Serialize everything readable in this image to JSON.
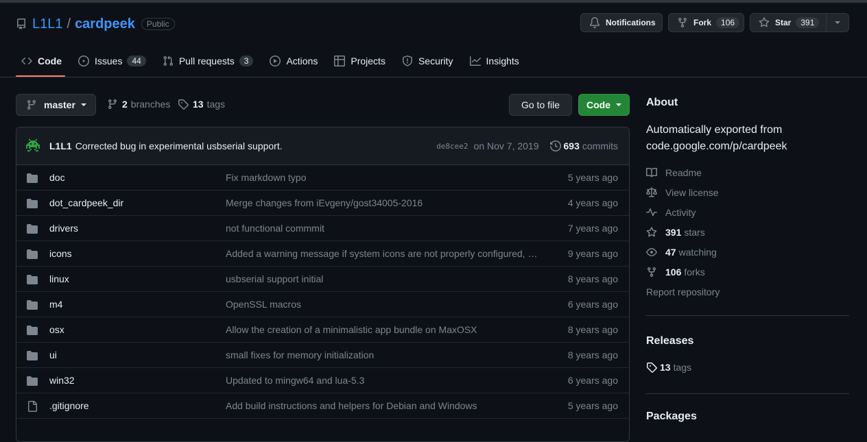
{
  "repo": {
    "owner": "L1L1",
    "separator": "/",
    "name": "cardpeek",
    "visibility": "Public"
  },
  "header_actions": {
    "notifications_label": "Notifications",
    "fork_label": "Fork",
    "fork_count": "106",
    "star_label": "Star",
    "star_count": "391"
  },
  "tabs": [
    {
      "label": "Code",
      "icon": "code-icon",
      "active": true
    },
    {
      "label": "Issues",
      "icon": "issue-icon",
      "count": "44"
    },
    {
      "label": "Pull requests",
      "icon": "pull-request-icon",
      "count": "3"
    },
    {
      "label": "Actions",
      "icon": "play-icon"
    },
    {
      "label": "Projects",
      "icon": "table-icon"
    },
    {
      "label": "Security",
      "icon": "shield-icon"
    },
    {
      "label": "Insights",
      "icon": "graph-icon"
    }
  ],
  "branch_bar": {
    "branch": "master",
    "branches_count": "2",
    "branches_label": "branches",
    "tags_count": "13",
    "tags_label": "tags",
    "goto_label": "Go to file",
    "code_label": "Code"
  },
  "latest_commit": {
    "author": "L1L1",
    "message": "Corrected bug in experimental usbserial support.",
    "sha": "de8cee2",
    "date": "on Nov 7, 2019",
    "commits_count": "693",
    "commits_label": "commits"
  },
  "files": [
    {
      "name": "doc",
      "type": "dir",
      "message": "Fix markdown typo",
      "age": "5 years ago"
    },
    {
      "name": "dot_cardpeek_dir",
      "type": "dir",
      "message": "Merge changes from iEvgeny/gost34005-2016",
      "age": "4 years ago"
    },
    {
      "name": "drivers",
      "type": "dir",
      "message": "not functional commmit",
      "age": "7 years ago"
    },
    {
      "name": "icons",
      "type": "dir",
      "message": "Added a warning message if system icons are not properly configured, …",
      "age": "9 years ago"
    },
    {
      "name": "linux",
      "type": "dir",
      "message": "usbserial support initial",
      "age": "8 years ago"
    },
    {
      "name": "m4",
      "type": "dir",
      "message": "OpenSSL macros",
      "age": "6 years ago"
    },
    {
      "name": "osx",
      "type": "dir",
      "message": "Allow the creation of a minimalistic app bundle on MaxOSX",
      "age": "8 years ago"
    },
    {
      "name": "ui",
      "type": "dir",
      "message": "small fixes for memory initialization",
      "age": "8 years ago"
    },
    {
      "name": "win32",
      "type": "dir",
      "message": "Updated to mingw64 and lua-5.3",
      "age": "6 years ago"
    },
    {
      "name": ".gitignore",
      "type": "file",
      "message": "Add build instructions and helpers for Debian and Windows",
      "age": "5 years ago"
    }
  ],
  "about": {
    "heading": "About",
    "description": "Automatically exported from code.google.com/p/cardpeek",
    "readme": "Readme",
    "license": "View license",
    "activity": "Activity",
    "stars_count": "391",
    "stars_label": "stars",
    "watching_count": "47",
    "watching_label": "watching",
    "forks_count": "106",
    "forks_label": "forks",
    "report": "Report repository"
  },
  "releases": {
    "heading": "Releases",
    "tags_count": "13",
    "tags_label": "tags"
  },
  "packages": {
    "heading": "Packages"
  },
  "colors": {
    "background": "#0d1117",
    "link": "#4493f8",
    "primary_button": "#238636",
    "tab_underline": "#f78166",
    "muted": "#7d8590"
  }
}
